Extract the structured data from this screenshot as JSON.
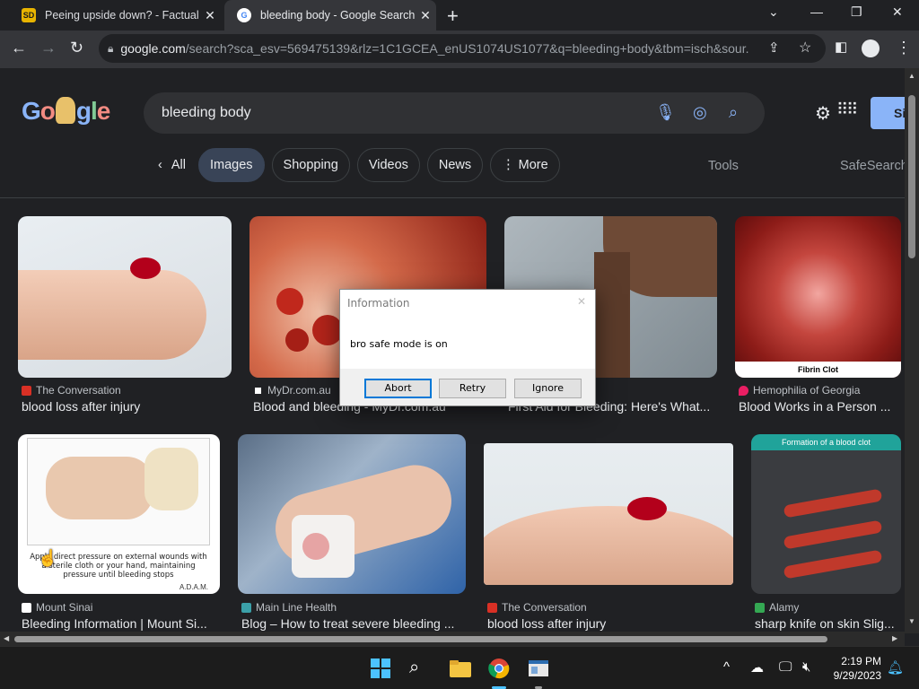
{
  "browser": {
    "tabs": [
      {
        "title": "Peeing upside down? - Factual C",
        "favicon": "SD",
        "active": false
      },
      {
        "title": "bleeding body - Google Search",
        "favicon": "G",
        "active": true
      }
    ],
    "url_host": "google.com",
    "url_rest": "/search?sca_esv=569475139&rlz=1C1GCEA_enUS1074US1077&q=bleeding+body&tbm=isch&sour..."
  },
  "google": {
    "logo_text": "Google",
    "query": "bleeding body",
    "signin_label": "Si",
    "chips": {
      "back": "All",
      "images": "Images",
      "shopping": "Shopping",
      "videos": "Videos",
      "news": "News",
      "more": "More"
    },
    "tools_label": "Tools",
    "safesearch_label": "SafeSearch"
  },
  "results": [
    {
      "source": "The Conversation",
      "caption": "blood loss after injury"
    },
    {
      "source": "MyDr.com.au",
      "caption": "Blood and bleeding - MyDr.com.au"
    },
    {
      "source": "",
      "caption": "First Aid for Bleeding: Here's What..."
    },
    {
      "source": "Hemophilia of Georgia",
      "caption": "Blood Works in a Person ..."
    },
    {
      "source": "Mount Sinai",
      "caption": "Bleeding Information | Mount Si..."
    },
    {
      "source": "Main Line Health",
      "caption": "Blog – How to treat severe bleeding ..."
    },
    {
      "source": "The Conversation",
      "caption": "blood loss after injury"
    },
    {
      "source": "Alamy",
      "caption": "sharp knife on skin Slig..."
    }
  ],
  "image_text": {
    "fibrin_clot": "Fibrin Clot",
    "mount_sinai_caption": "Apply direct pressure on external wounds with a sterile cloth or your hand, maintaining pressure until bleeding stops",
    "adam": "A.D.A.M.",
    "alamy_title": "Formation of a blood clot"
  },
  "dialog": {
    "title": "Information",
    "message": "bro safe mode is on",
    "buttons": {
      "abort": "Abort",
      "retry": "Retry",
      "ignore": "Ignore"
    }
  },
  "taskbar": {
    "time": "2:19 PM",
    "date": "9/29/2023"
  },
  "colors": {
    "page_bg": "#202124",
    "accent": "#8ab4f8",
    "selected_chip": "#394457"
  }
}
